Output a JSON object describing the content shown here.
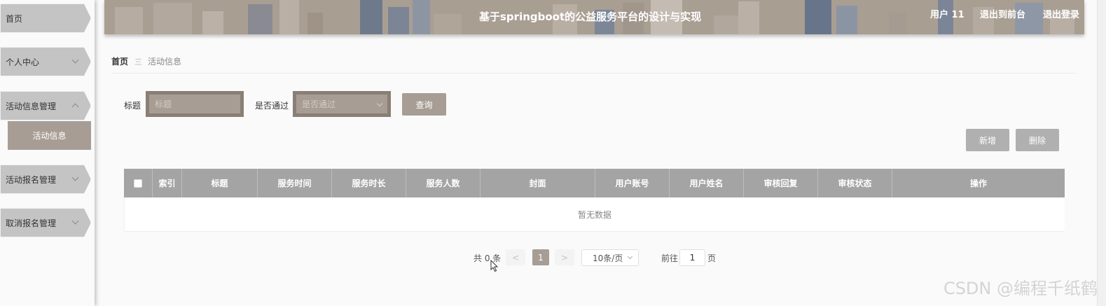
{
  "header": {
    "title": "基于springboot的公益服务平台的设计与实现",
    "user": "用户 11",
    "back_front": "退出到前台",
    "logout": "退出登录"
  },
  "sidebar": {
    "items": [
      {
        "label": "首页"
      },
      {
        "label": "个人中心"
      },
      {
        "label": "活动信息管理"
      },
      {
        "label": "活动报名管理"
      },
      {
        "label": "取消报名管理"
      }
    ],
    "sub_active": "活动信息"
  },
  "breadcrumb": {
    "home": "首页",
    "separator": "三",
    "current": "活动信息"
  },
  "search": {
    "title_label": "标题",
    "title_placeholder": "标题",
    "pass_label": "是否通过",
    "pass_placeholder": "是否通过",
    "query_button": "查询"
  },
  "actions": {
    "add": "新增",
    "delete": "删除"
  },
  "table": {
    "columns": [
      "索引",
      "标题",
      "服务时间",
      "服务时长",
      "服务人数",
      "封面",
      "用户账号",
      "用户姓名",
      "审核回复",
      "审核状态",
      "操作"
    ],
    "empty_text": "暂无数据"
  },
  "pagination": {
    "total": "共 0 条",
    "prev": "<",
    "page": "1",
    "next": ">",
    "page_size": "10条/页",
    "goto_label": "前往",
    "goto_value": "1",
    "goto_unit": "页"
  },
  "watermark": "CSDN @编程千纸鹤",
  "colors": {
    "accent": "#a79d94",
    "header": "#a99e92",
    "table_head": "#a4a4a4",
    "button_gray": "#b0b0b0"
  }
}
